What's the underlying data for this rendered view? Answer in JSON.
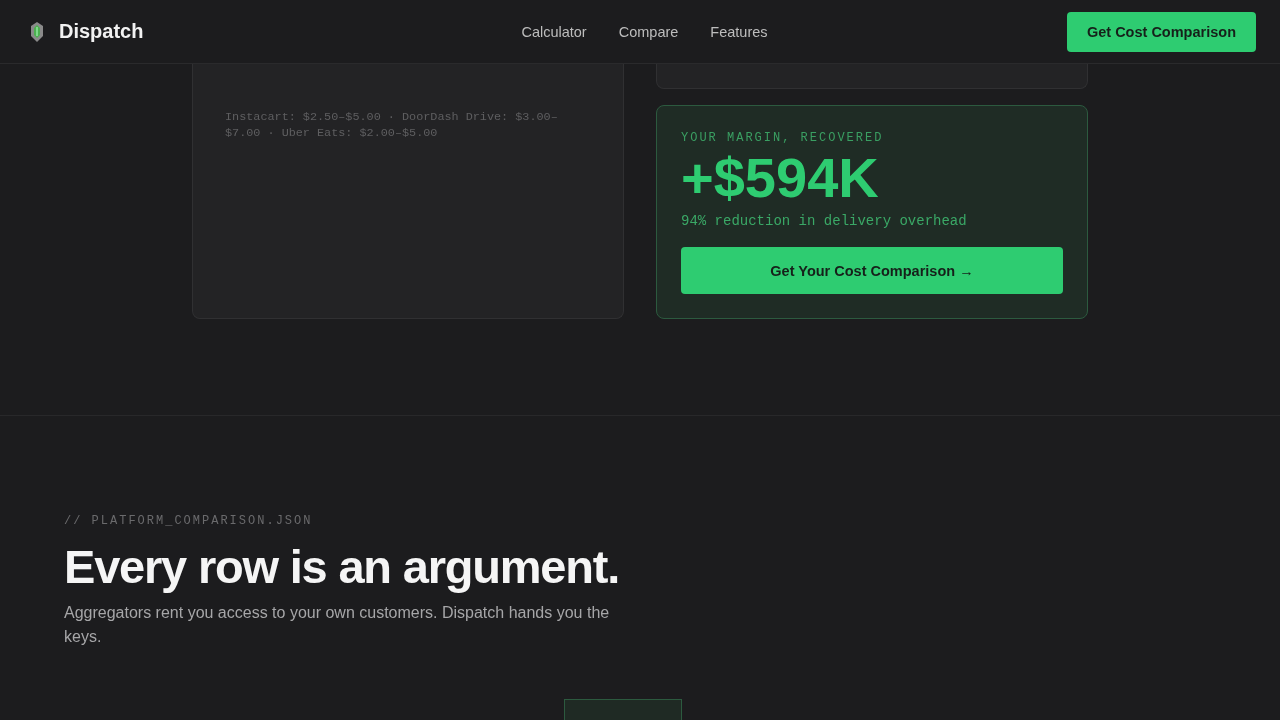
{
  "header": {
    "brand": "Dispatch",
    "nav": [
      {
        "label": "Calculator"
      },
      {
        "label": "Compare"
      },
      {
        "label": "Features"
      }
    ],
    "cta": "Get Cost Comparison"
  },
  "calculator": {
    "rates_note": "Instacart: $2.50–$5.00 · DoorDash Drive: $3.00–$7.00 · Uber Eats: $2.00–$5.00"
  },
  "savings": {
    "label": "YOUR MARGIN, RECOVERED",
    "amount": "+$594K",
    "reduction": "94% reduction in delivery overhead",
    "button": "Get Your Cost Comparison →"
  },
  "comparison": {
    "eyebrow": "// PLATFORM_COMPARISON.JSON",
    "heading": "Every row is an argument.",
    "intro": "Aggregators rent you access to your own customers. Dispatch hands you the keys."
  }
}
